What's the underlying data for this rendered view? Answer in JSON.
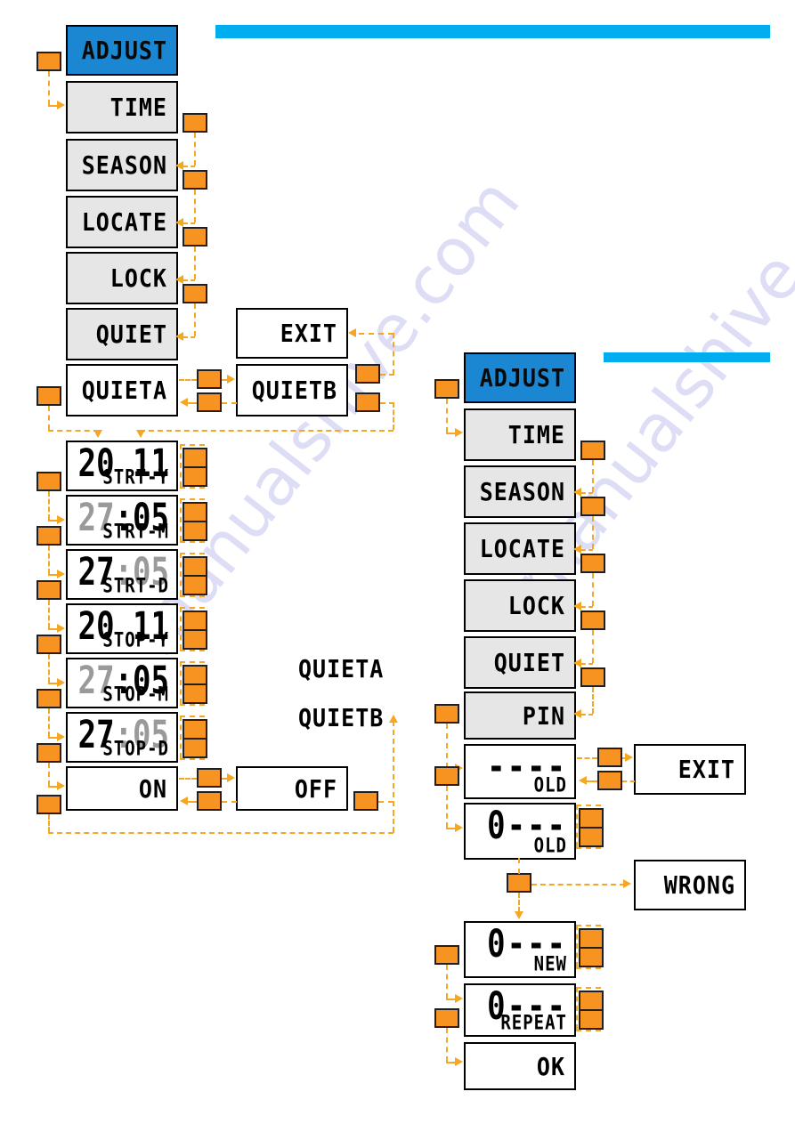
{
  "meta": {
    "accent_blue": "#00aeef",
    "lcd_selected_blue": "#1b86d1",
    "button_orange": "#f79421",
    "connector_orange": "#f5a623",
    "lcd_grey": "#e6e6e6",
    "dim_digit_grey": "#9a9a9a"
  },
  "watermark": {
    "line_a": "manualshive",
    "line_b": "manualshive.com"
  },
  "left_flow": {
    "menu": [
      {
        "label": "ADJUST",
        "state": "selected"
      },
      {
        "label": "TIME",
        "state": "grey"
      },
      {
        "label": "SEASON",
        "state": "grey"
      },
      {
        "label": "LOCATE",
        "state": "grey"
      },
      {
        "label": "LOCK",
        "state": "grey"
      },
      {
        "label": "QUIET",
        "state": "grey"
      }
    ],
    "quieta": {
      "label": "QUIETA",
      "state": "white"
    },
    "quietb": {
      "label": "QUIETB",
      "state": "white"
    },
    "exit": {
      "label": "EXIT",
      "state": "white"
    },
    "date_rows": [
      {
        "big_dim": "",
        "big_lit": "20 11",
        "sub": "STRT-Y"
      },
      {
        "big_dim": "27",
        "big_lit": ":05",
        "sub": "STRT-M"
      },
      {
        "big_dim": "",
        "big_lit": "27",
        "sub": "STRT-D",
        "big_tail_dim": ":05"
      },
      {
        "big_dim": "",
        "big_lit": "20 11",
        "sub": "STOP-Y"
      },
      {
        "big_dim": "27",
        "big_lit": ":05",
        "sub": "STOP-M"
      },
      {
        "big_dim": "",
        "big_lit": "27",
        "sub": "STOP-D",
        "big_tail_dim": ":05"
      }
    ],
    "on": {
      "label": "ON",
      "state": "white"
    },
    "off": {
      "label": "OFF",
      "state": "white"
    },
    "free_labels": [
      {
        "label": "QUIETA"
      },
      {
        "label": "QUIETB"
      }
    ]
  },
  "right_flow": {
    "menu": [
      {
        "label": "ADJUST",
        "state": "selected"
      },
      {
        "label": "TIME",
        "state": "grey"
      },
      {
        "label": "SEASON",
        "state": "grey"
      },
      {
        "label": "LOCATE",
        "state": "grey"
      },
      {
        "label": "LOCK",
        "state": "grey"
      },
      {
        "label": "QUIET",
        "state": "grey"
      },
      {
        "label": "PIN",
        "state": "grey"
      }
    ],
    "pin_rows": [
      {
        "big": "----",
        "sub": "OLD"
      },
      {
        "big": "0---",
        "sub": "OLD"
      },
      {
        "big": "0---",
        "sub": "NEW"
      },
      {
        "big": "0---",
        "sub": "REPEAT"
      }
    ],
    "exit": {
      "label": "EXIT",
      "state": "white"
    },
    "wrong": {
      "label": "WRONG",
      "state": "white"
    },
    "ok": {
      "label": "OK",
      "state": "white"
    }
  }
}
